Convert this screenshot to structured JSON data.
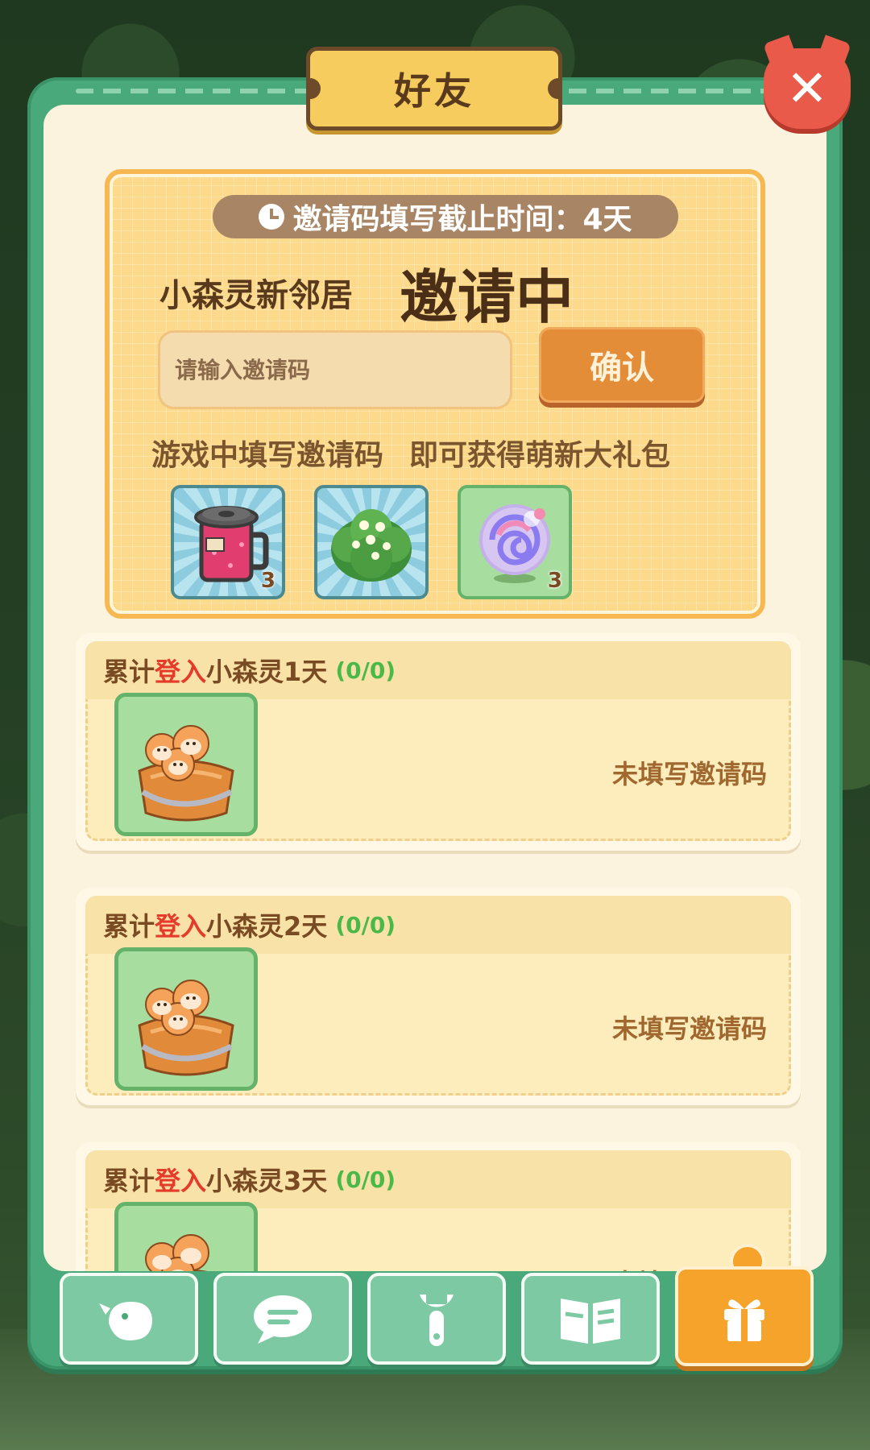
{
  "dialog": {
    "title": "好友",
    "close_icon": "close-icon"
  },
  "invite": {
    "deadline": "邀请码填写截止时间：4天",
    "subtitle": "小森灵新邻居",
    "headline": "邀请中",
    "input_placeholder": "请输入邀请码",
    "confirm_label": "确认",
    "desc_left": "游戏中填写邀请码",
    "desc_right": "即可获得萌新大礼包",
    "rewards": [
      {
        "icon": "drink-cup-icon",
        "count": "3"
      },
      {
        "icon": "flower-bush-icon",
        "count": ""
      },
      {
        "icon": "swirl-orb-icon",
        "count": "3"
      }
    ]
  },
  "tasks": [
    {
      "prefix": "累计",
      "highlight": "登入",
      "suffix": "小森灵1天",
      "progress": "(0/0)",
      "status": "未填写邀请码",
      "reward_icon": "squirrel-basket-icon"
    },
    {
      "prefix": "累计",
      "highlight": "登入",
      "suffix": "小森灵2天",
      "progress": "(0/0)",
      "status": "未填写邀请码",
      "reward_icon": "squirrel-basket-icon"
    },
    {
      "prefix": "累计",
      "highlight": "登入",
      "suffix": "小森灵3天",
      "progress": "(0/0)",
      "status": "未填写邀请码",
      "reward_icon": "squirrel-basket-icon"
    }
  ],
  "tabs": [
    {
      "icon": "chick-icon"
    },
    {
      "icon": "chat-bubble-icon"
    },
    {
      "icon": "wrench-icon"
    },
    {
      "icon": "book-icon"
    },
    {
      "icon": "gift-icon"
    }
  ],
  "colors": {
    "panel_green": "#4aa97a",
    "card_yellow": "#fdd98c",
    "accent_red": "#e53b2b",
    "progress_green": "#4bb84a",
    "active_tab_orange": "#f6a32c"
  }
}
